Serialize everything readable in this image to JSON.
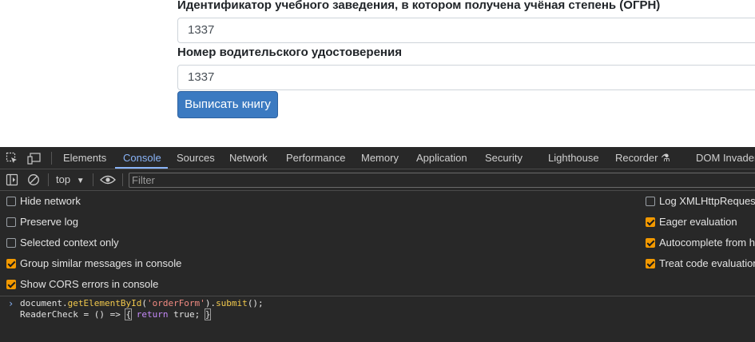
{
  "form": {
    "label_ogrn": "Идентификатор учебного заведения, в котором получена учёная степень (ОГРН)",
    "value_ogrn": "1337",
    "label_license": "Номер водительского удостоверения",
    "value_license": "1337",
    "submit_label": "Выписать книгу"
  },
  "devtools": {
    "tabs": [
      "Elements",
      "Console",
      "Sources",
      "Network",
      "Performance",
      "Memory",
      "Application",
      "Security",
      "Lighthouse",
      "Recorder",
      "DOM Invader"
    ],
    "active_tab": "Console",
    "context": "top",
    "filter_placeholder": "Filter",
    "settings_left": [
      {
        "label": "Hide network",
        "checked": false
      },
      {
        "label": "Preserve log",
        "checked": false
      },
      {
        "label": "Selected context only",
        "checked": false
      },
      {
        "label": "Group similar messages in console",
        "checked": true
      },
      {
        "label": "Show CORS errors in console",
        "checked": true
      }
    ],
    "settings_right": [
      {
        "label": "Log XMLHttpRequests",
        "checked": false
      },
      {
        "label": "Eager evaluation",
        "checked": true
      },
      {
        "label": "Autocomplete from hi",
        "checked": true
      },
      {
        "label": "Treat code evaluation",
        "checked": true
      }
    ],
    "console_lines": [
      "document.getElementById('orderForm').submit();",
      "ReaderCheck = () => { return true; }"
    ]
  },
  "colors": {
    "accent": "#8ab4f8",
    "checkbox": "#f29900",
    "button": "#3b7ac1",
    "panel_bg": "#282828"
  }
}
